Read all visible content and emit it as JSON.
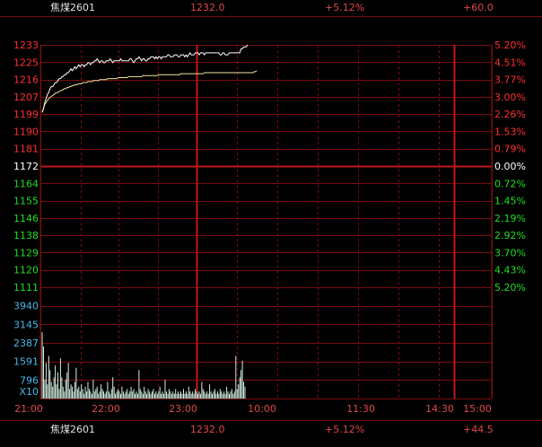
{
  "header_top": {
    "name": "焦煤2601",
    "price": "1232.0",
    "pct": "+5.12%",
    "change": "+60.0"
  },
  "header_bottom": {
    "name": "焦煤2601",
    "price": "1232.0",
    "pct": "+5.12%",
    "change": "+44.5"
  },
  "colors": {
    "grid": "#7a0d0d",
    "up": "#ff3030",
    "down": "#22dd22",
    "neutral": "#ffffff",
    "volume_axis": "#46b8e6",
    "price_line": "#ffffff",
    "avg_line": "#f2e6a0",
    "volume_bar": "#cfeee0"
  },
  "chart_data": {
    "type": "line",
    "x_ticks": [
      "21:00",
      "22:00",
      "23:00",
      "10:00",
      "11:30",
      "14:30",
      "15:00"
    ],
    "price_ticks": [
      "1233",
      "1225",
      "1216",
      "1207",
      "1199",
      "1190",
      "1181",
      "1172",
      "1164",
      "1155",
      "1146",
      "1138",
      "1129",
      "1120",
      "1111"
    ],
    "pct_ticks": [
      "5.20%",
      "4.51%",
      "3.77%",
      "3.00%",
      "2.26%",
      "1.53%",
      "0.79%",
      "0.00%",
      "0.72%",
      "1.45%",
      "2.19%",
      "2.92%",
      "3.70%",
      "4.43%",
      "5.20%"
    ],
    "pct_direction": [
      "up",
      "up",
      "up",
      "up",
      "up",
      "up",
      "up",
      "neutral",
      "down",
      "down",
      "down",
      "down",
      "down",
      "down",
      "down"
    ],
    "volume_ticks": [
      "3940",
      "3145",
      "2387",
      "1591",
      "796"
    ],
    "volume_unit": "X10",
    "ylim": [
      1111,
      1233
    ],
    "base_price": 1172,
    "session_minutes": 345,
    "price_series": [
      1199,
      1201,
      1204,
      1206,
      1208,
      1209,
      1211,
      1212,
      1212,
      1213,
      1214,
      1214,
      1215,
      1216,
      1216,
      1217,
      1217,
      1218,
      1218,
      1219,
      1219,
      1220,
      1221,
      1220,
      1221,
      1222,
      1221,
      1222,
      1223,
      1222,
      1223,
      1223,
      1222,
      1223,
      1223,
      1224,
      1224,
      1223,
      1224,
      1224,
      1225,
      1225,
      1226,
      1225,
      1224,
      1225,
      1225,
      1224,
      1224,
      1225,
      1225,
      1225,
      1226,
      1225,
      1224,
      1225,
      1225,
      1225,
      1225,
      1225,
      1226,
      1225,
      1225,
      1225,
      1225,
      1225,
      1225,
      1226,
      1226,
      1225,
      1224,
      1225,
      1226,
      1226,
      1227,
      1226,
      1225,
      1226,
      1226,
      1225,
      1225,
      1226,
      1226,
      1227,
      1227,
      1227,
      1226,
      1227,
      1226,
      1227,
      1227,
      1226,
      1227,
      1227,
      1227,
      1227,
      1228,
      1228,
      1227,
      1227,
      1227,
      1228,
      1228,
      1228,
      1227,
      1227,
      1228,
      1228,
      1228,
      1227,
      1228,
      1227,
      1228,
      1229,
      1228,
      1228,
      1228,
      1229,
      1229,
      1229,
      1228,
      1229,
      1229,
      1229,
      1228,
      1229,
      1229,
      1229,
      1229,
      1229,
      1229,
      1229,
      1229,
      1229,
      1229,
      1229,
      1228,
      1228,
      1229,
      1229,
      1228,
      1228,
      1228,
      1229,
      1229,
      1229,
      1229,
      1229,
      1229,
      1229,
      1229,
      1229,
      1231,
      1231,
      1232,
      1232,
      1232,
      1233
    ],
    "avg_series": [
      1199,
      1201,
      1203,
      1204,
      1205,
      1206,
      1206.5,
      1207,
      1207.5,
      1208,
      1208.5,
      1209,
      1209,
      1209.5,
      1210,
      1210,
      1210.5,
      1211,
      1211,
      1211.5,
      1211.5,
      1212,
      1212,
      1212.5,
      1212.5,
      1213,
      1213,
      1213,
      1213.5,
      1213.5,
      1213.5,
      1214,
      1214,
      1214,
      1214,
      1214.5,
      1214.5,
      1214.5,
      1214.5,
      1215,
      1215,
      1215,
      1215,
      1215,
      1215.5,
      1215.5,
      1215.5,
      1215.5,
      1215.5,
      1215.5,
      1216,
      1216,
      1216,
      1216,
      1216,
      1216,
      1216,
      1216,
      1216.5,
      1216.5,
      1216.5,
      1216.5,
      1216.5,
      1216.5,
      1216.5,
      1216.5,
      1217,
      1217,
      1217,
      1217,
      1217,
      1217,
      1217,
      1217,
      1217,
      1217,
      1217,
      1217.5,
      1217.5,
      1217.5,
      1217.5,
      1217.5,
      1217.5,
      1217.5,
      1217.5,
      1217.5,
      1217.5,
      1217.5,
      1217.5,
      1218,
      1218,
      1218,
      1218,
      1218,
      1218,
      1218,
      1218,
      1218,
      1218,
      1218,
      1218,
      1218,
      1218,
      1218,
      1218,
      1218,
      1218.5,
      1218.5,
      1218.5,
      1218.5,
      1218.5,
      1218.5,
      1218.5,
      1218.5,
      1218.5,
      1218.5,
      1218.5,
      1218.5,
      1218.5,
      1218.5,
      1218.5,
      1218.5,
      1218.5,
      1218.5,
      1219,
      1219,
      1219,
      1219,
      1219,
      1219,
      1219,
      1219,
      1219,
      1219,
      1219,
      1219,
      1219,
      1219,
      1219,
      1219,
      1219,
      1219,
      1219,
      1219,
      1219,
      1219,
      1219,
      1219,
      1219,
      1219,
      1219,
      1219,
      1219,
      1219,
      1219,
      1219,
      1219,
      1219,
      1219,
      1219,
      1219,
      1219,
      1219.5,
      1219.5,
      1220
    ],
    "volume_series": [
      2800,
      2200,
      800,
      1500,
      600,
      1800,
      1200,
      700,
      500,
      900,
      1400,
      600,
      1100,
      400,
      1700,
      900,
      500,
      300,
      800,
      1100,
      1500,
      400,
      600,
      500,
      300,
      700,
      1300,
      400,
      500,
      300,
      600,
      400,
      200,
      500,
      300,
      700,
      400,
      300,
      200,
      800,
      300,
      400,
      500,
      200,
      300,
      600,
      400,
      300,
      200,
      300,
      700,
      300,
      200,
      400,
      900,
      500,
      200,
      300,
      400,
      300,
      200,
      500,
      300,
      200,
      300,
      400,
      200,
      300,
      500,
      300,
      400,
      200,
      300,
      200,
      1200,
      400,
      300,
      200,
      500,
      300,
      200,
      400,
      300,
      200,
      300,
      400,
      200,
      300,
      200,
      300,
      500,
      200,
      300,
      200,
      800,
      300,
      200,
      400,
      300,
      200,
      300,
      200,
      400,
      200,
      300,
      200,
      300,
      200,
      400,
      200,
      300,
      200,
      500,
      300,
      200,
      300,
      200,
      400,
      300,
      200,
      300,
      200,
      700,
      400,
      300,
      200,
      300,
      200,
      600,
      300,
      200,
      300,
      400,
      200,
      300,
      200,
      400,
      300,
      200,
      300,
      200,
      500,
      300,
      200,
      300,
      400,
      200,
      300,
      1800,
      400,
      600,
      900,
      1200,
      1600,
      700,
      500
    ]
  }
}
